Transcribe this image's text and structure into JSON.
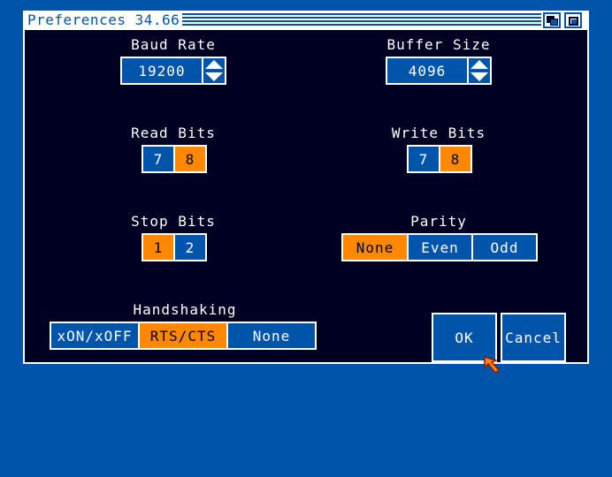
{
  "window": {
    "title": "Preferences 34.66"
  },
  "baud_rate": {
    "label": "Baud Rate",
    "value": "19200"
  },
  "buffer_size": {
    "label": "Buffer Size",
    "value": "4096"
  },
  "read_bits": {
    "label": "Read Bits",
    "options": [
      "7",
      "8"
    ],
    "selected": "8"
  },
  "write_bits": {
    "label": "Write Bits",
    "options": [
      "7",
      "8"
    ],
    "selected": "8"
  },
  "stop_bits": {
    "label": "Stop Bits",
    "options": [
      "1",
      "2"
    ],
    "selected": "1"
  },
  "parity": {
    "label": "Parity",
    "options": [
      "None",
      "Even",
      "Odd"
    ],
    "selected": "None"
  },
  "handshaking": {
    "label": "Handshaking",
    "options": [
      "xON/xOFF",
      "RTS/CTS",
      "None"
    ],
    "selected": "RTS/CTS"
  },
  "buttons": {
    "ok": "OK",
    "cancel": "Cancel"
  },
  "colors": {
    "background": "#0055aa",
    "window": "#000022",
    "accent": "#ff8800",
    "text": "#ffffff"
  }
}
